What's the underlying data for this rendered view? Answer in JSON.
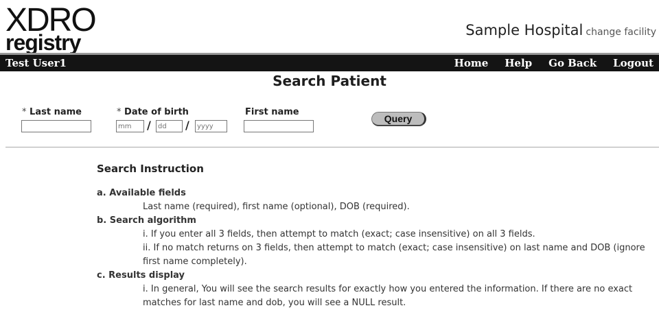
{
  "logo": {
    "line1": "XDRO",
    "line2": "registry"
  },
  "header": {
    "facility": "Sample Hospital",
    "change_facility": "change facility"
  },
  "nav": {
    "user": "Test User1",
    "links": [
      "Home",
      "Help",
      "Go Back",
      "Logout"
    ]
  },
  "page": {
    "title": "Search Patient"
  },
  "form": {
    "required_marker": "*",
    "last_name_label": "Last name",
    "dob_label": "Date of birth",
    "first_name_label": "First name",
    "dob_separator": "/",
    "mm_placeholder": "mm",
    "dd_placeholder": "dd",
    "yyyy_placeholder": "yyyy",
    "query_button": "Query"
  },
  "instructions": {
    "heading": "Search Instruction",
    "a_title": "a. Available fields",
    "a_text": "Last name (required), first name (optional), DOB (required).",
    "b_title": "b. Search algorithm",
    "b_i": "i. If you enter all 3 fields, then attempt to match (exact; case insensitive) on all 3 fields.",
    "b_ii": "ii. If no match returns on 3 fields, then attempt to match (exact; case insensitive) on last name and DOB (ignore first name completely).",
    "c_title": "c. Results display",
    "c_i": "i. In general, You will see the search results for exactly how you entered the information. If there are no exact matches for last name and dob, you will see a NULL result."
  }
}
